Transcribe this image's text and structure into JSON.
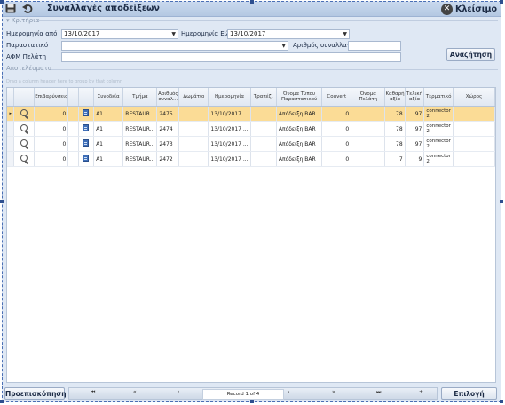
{
  "window": {
    "title": "Συναλλαγές αποδείξεων",
    "close_label": "Κλείσιμο"
  },
  "criteria": {
    "header": "Κριτήρια",
    "date_from_label": "Ημερομηνία από",
    "date_from_value": "13/10/2017",
    "date_to_label": "Ημερομηνία Εώς",
    "date_to_value": "13/10/2017",
    "documents_label": "Παραστατικό",
    "documents_value": "",
    "transaction_no_label": "Αριθμός συναλλαγής",
    "transaction_no_value": "",
    "customer_vat_label": "ΑΦΜ Πελάτη",
    "customer_vat_value": "",
    "search_button": "Αναζήτηση"
  },
  "results": {
    "header": "Αποτελέσματα",
    "group_hint": "Drag a column header here to group by that column",
    "columns": [
      "",
      "",
      "Επιβαρύνσεις",
      "",
      "",
      "Συνοδεία",
      "Τμήμα",
      "Αριθμός συναλ...",
      "Δωμάτιο",
      "Ημερομηνία",
      "Τραπέζι",
      "Όνομα Τύπου Παραστατικού",
      "Couvert",
      "Όνομα Πελάτη",
      "Καθαρή αξία",
      "Τελική αξία",
      "Τερματικό",
      "Χώρος"
    ],
    "rows": [
      {
        "indicator": "▸",
        "charges": "0",
        "escort": "A1",
        "department": "RESTAUR...",
        "trans_no": "2475",
        "room": "",
        "date": "13/10/2017 ...",
        "table": "",
        "doc_type": "Απόδειξη BAR",
        "couvert": "0",
        "customer": "",
        "net": "78",
        "total": "97",
        "terminal": "connector 2",
        "area": ""
      },
      {
        "indicator": "",
        "charges": "0",
        "escort": "A1",
        "department": "RESTAUR...",
        "trans_no": "2474",
        "room": "",
        "date": "13/10/2017 ...",
        "table": "",
        "doc_type": "Απόδειξη BAR",
        "couvert": "0",
        "customer": "",
        "net": "78",
        "total": "97",
        "terminal": "connector 2",
        "area": ""
      },
      {
        "indicator": "",
        "charges": "0",
        "escort": "A1",
        "department": "RESTAUR...",
        "trans_no": "2473",
        "room": "",
        "date": "13/10/2017 ...",
        "table": "",
        "doc_type": "Απόδειξη BAR",
        "couvert": "0",
        "customer": "",
        "net": "78",
        "total": "97",
        "terminal": "connector 2",
        "area": ""
      },
      {
        "indicator": "",
        "charges": "0",
        "escort": "A1",
        "department": "RESTAUR...",
        "trans_no": "2472",
        "room": "",
        "date": "13/10/2017 ...",
        "table": "",
        "doc_type": "Απόδειξη BAR",
        "couvert": "0",
        "customer": "",
        "net": "7",
        "total": "9",
        "terminal": "connector 2",
        "area": ""
      }
    ]
  },
  "footer": {
    "preview_button": "Προεπισκόπηση",
    "select_button": "Επιλογή",
    "record_text": "Record 1 of 4",
    "nav": [
      "⏮",
      "«",
      "‹",
      "›",
      "»",
      "⏭",
      "+",
      "−"
    ]
  }
}
